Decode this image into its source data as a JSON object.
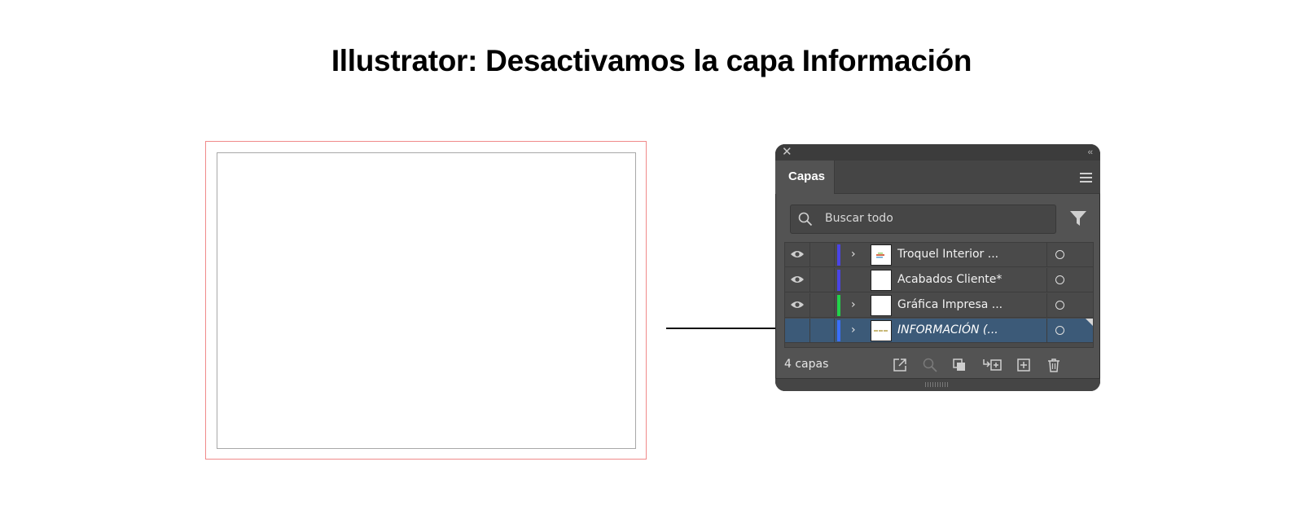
{
  "page": {
    "title": "Illustrator: Desactivamos la capa Información"
  },
  "colors": {
    "accent_selected": "#3c5a78",
    "layer_blue": "#4a44e6",
    "layer_green": "#22d24a",
    "layer_selected_blue": "#3a6fff",
    "artboard_bleed": "#f08a8a"
  },
  "panel": {
    "tab_label": "Capas",
    "search": {
      "placeholder": "Buscar todo"
    },
    "layers": [
      {
        "name": "Troquel Interior ...",
        "visible": true,
        "expandable": true,
        "color": "#4a44e6",
        "selected": false
      },
      {
        "name": "Acabados Cliente*",
        "visible": true,
        "expandable": false,
        "color": "#4a44e6",
        "selected": false
      },
      {
        "name": "Gráfica Impresa ...",
        "visible": true,
        "expandable": true,
        "color": "#22d24a",
        "selected": false
      },
      {
        "name": "INFORMACIÓN (...",
        "visible": false,
        "expandable": true,
        "color": "#3a6fff",
        "selected": true
      }
    ],
    "footer": {
      "count_label": "4 capas",
      "tools": [
        "export-icon",
        "locate-icon",
        "clipping-mask-icon",
        "new-sublayer-icon",
        "new-layer-icon",
        "delete-icon"
      ]
    }
  }
}
